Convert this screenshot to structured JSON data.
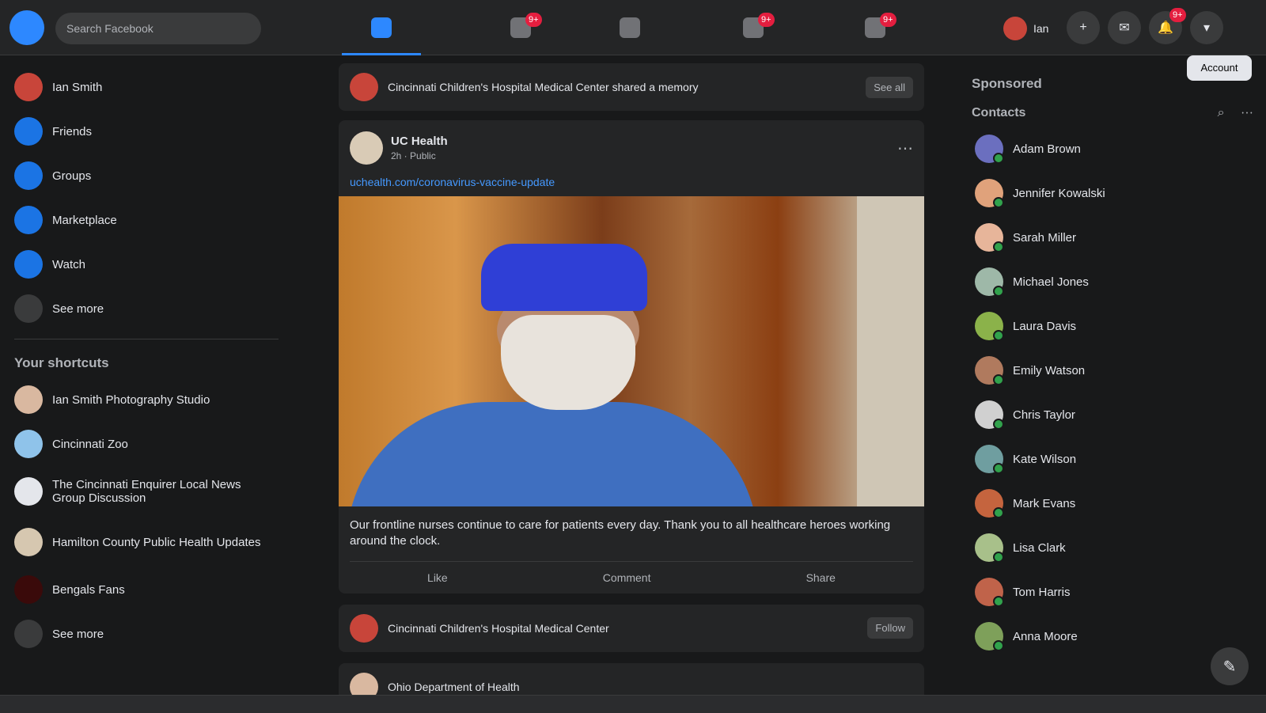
{
  "header": {
    "search_placeholder": "Search Facebook",
    "nav": [
      {
        "icon": "home-icon",
        "badge": ""
      },
      {
        "icon": "watch-icon",
        "badge": "9+"
      },
      {
        "icon": "marketplace-icon",
        "badge": ""
      },
      {
        "icon": "groups-icon",
        "badge": "9+"
      },
      {
        "icon": "gaming-icon",
        "badge": "9+"
      }
    ],
    "profile_name": "Ian",
    "notifications_badge": "9+",
    "tooltip": "Account"
  },
  "sidebar": {
    "items": [
      {
        "label": "Ian Smith",
        "icon": "avatar-icon",
        "color": "#c8453a"
      },
      {
        "label": "Friends",
        "icon": "friends-icon",
        "color": "#1b74e4"
      },
      {
        "label": "Groups",
        "icon": "groups-icon",
        "color": "#1b74e4"
      },
      {
        "label": "Marketplace",
        "icon": "marketplace-icon",
        "color": "#1b74e4"
      },
      {
        "label": "Watch",
        "icon": "watch-icon",
        "color": "#1b74e4"
      },
      {
        "label": "See more",
        "icon": "chevron-down-icon",
        "color": "#3a3b3c"
      }
    ],
    "shortcuts_title": "Your shortcuts",
    "shortcuts": [
      {
        "label": "Ian Smith Photography Studio",
        "color": "#d9b8a0"
      },
      {
        "label": "Cincinnati Zoo",
        "color": "#8fc3ea"
      },
      {
        "label": "The Cincinnati Enquirer Local News Group Discussion",
        "color": "#e4e6eb"
      },
      {
        "label": "Hamilton County Public Health Updates",
        "color": "#d6c7b0"
      },
      {
        "label": "Bengals Fans",
        "color": "#3a0a0a"
      },
      {
        "label": "See more",
        "color": "#3a3b3c"
      }
    ]
  },
  "feed": {
    "top_strip": {
      "text": "Cincinnati Children's Hospital Medical Center shared a memory",
      "button": "See all"
    },
    "post": {
      "author": "UC Health",
      "meta": "2h · Public",
      "link_text": "uchealth.com/coronavirus-vaccine-update",
      "text": "Our frontline nurses continue to care for patients every day. Thank you to all healthcare heroes working around the clock.",
      "actions": [
        "Like",
        "Comment",
        "Share"
      ]
    },
    "bottom_strip": {
      "text": "Cincinnati Children's Hospital Medical Center",
      "button": "Follow"
    },
    "next_post_author": "Ohio Department of Health"
  },
  "right_sidebar": {
    "section_title": "Sponsored",
    "contacts_title": "Contacts",
    "contacts_icons": "⌕ ⋯",
    "contacts": [
      {
        "name": "Adam Brown",
        "color": "#6b6fbf"
      },
      {
        "name": "Jennifer Kowalski",
        "color": "#e0a27b"
      },
      {
        "name": "Sarah Miller",
        "color": "#e7b59a"
      },
      {
        "name": "Michael Jones",
        "color": "#9eb8a8"
      },
      {
        "name": "Laura Davis",
        "color": "#8bb24a"
      },
      {
        "name": "Emily Watson",
        "color": "#b07a5e"
      },
      {
        "name": "Chris Taylor",
        "color": "#d0d0d0"
      },
      {
        "name": "Kate Wilson",
        "color": "#6f9ea0"
      },
      {
        "name": "Mark Evans",
        "color": "#c5643e"
      },
      {
        "name": "Lisa Clark",
        "color": "#a8c08a"
      },
      {
        "name": "Tom Harris",
        "color": "#c0634a"
      },
      {
        "name": "Anna Moore",
        "color": "#7ea05a"
      }
    ]
  },
  "fab_icon": "new-message-icon"
}
